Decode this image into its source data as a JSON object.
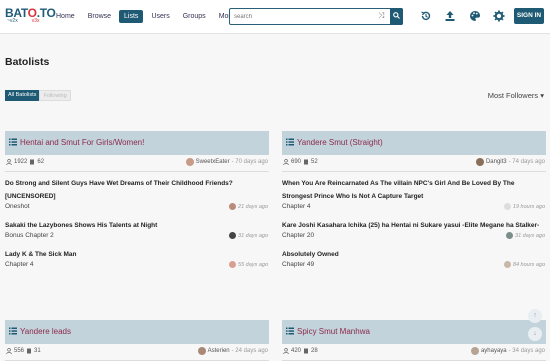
{
  "header": {
    "logo_main_a": "BAT",
    "logo_main_o": "O",
    "logo_main_b": ".TO",
    "logo_sub_left": "~v2x",
    "logo_sub_right": "v3x",
    "nav": [
      "Home",
      "Browse",
      "Lists",
      "Users",
      "Groups",
      "More..."
    ],
    "search_placeholder": "search",
    "sign_in": "SIGN IN",
    "icons": [
      "history-icon",
      "upload-icon",
      "palette-icon",
      "settings-icon"
    ]
  },
  "page": {
    "title": "Batolists",
    "tabs": [
      "All Batolists",
      "Following"
    ],
    "sort": "Most Followers ▾"
  },
  "cards": [
    {
      "title": "Hentai and Smut For Girls/Women!",
      "followers": "1922",
      "items": "62",
      "user": "SweetxEater",
      "ago": " - 70 days ago",
      "entries": [
        {
          "title": "Do Strong and Silent Guys Have Wet Dreams of Their Childhood Friends? [UNCENSORED]",
          "chapter": "Oneshot",
          "time": "21 days ago"
        },
        {
          "title": "Sakaki the Lazybones Shows His Talents at Night",
          "chapter": "Bonus Chapter 2",
          "time": "31 days ago"
        },
        {
          "title": "Lady K & The Sick Man",
          "chapter": "Chapter 4",
          "time": "55 days ago"
        }
      ]
    },
    {
      "title": "Yandere Smut (Straight)",
      "followers": "690",
      "items": "52",
      "user": "Dangit3",
      "ago": " - 74 days ago",
      "entries": [
        {
          "title": "When You Are Reincarnated As The villain NPC's Girl And Be Loved By The Strongest Prince Who Is Not A Capture Target",
          "chapter": "Chapter 4",
          "time": "19 hours ago"
        },
        {
          "title": "Kare Joshi Kasahara Ichika (25) ha Hentai ni Sukare yasui -Elite Megane ha Stalker-",
          "chapter": "Chapter 20",
          "time": "31 days ago"
        },
        {
          "title": "Absolutely Owned",
          "chapter": "Chapter 49",
          "time": "84 hours ago"
        }
      ]
    },
    {
      "title": "Yandere leads",
      "followers": "556",
      "items": "31",
      "user": "Asterien",
      "ago": " - 24 days ago",
      "entries": []
    },
    {
      "title": "Spicy Smut Manhwa",
      "followers": "420",
      "items": "28",
      "user": "ayhayaya",
      "ago": " - 34 days ago",
      "entries": []
    }
  ],
  "colors": {
    "accent": "#1e5a73",
    "card_header": "#c3d3db",
    "card_title": "#8b2a4b",
    "logo_red": "#d8333a"
  }
}
